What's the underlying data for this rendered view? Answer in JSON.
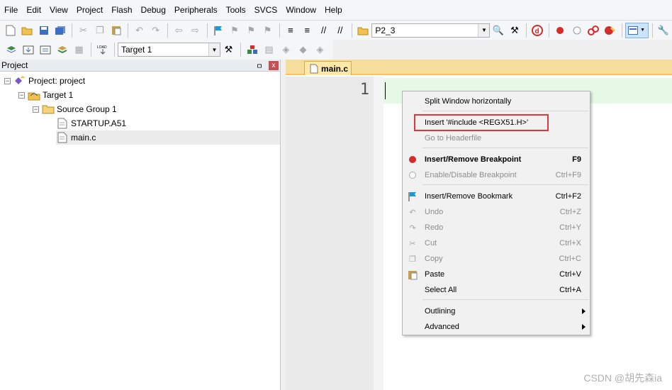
{
  "menu": [
    "File",
    "Edit",
    "View",
    "Project",
    "Flash",
    "Debug",
    "Peripherals",
    "Tools",
    "SVCS",
    "Window",
    "Help"
  ],
  "toolbar": {
    "find_combo_value": "P2_3",
    "target_combo_value": "Target 1"
  },
  "project_panel": {
    "title": "Project",
    "pin_glyph": "ㅁ",
    "close_glyph": "x",
    "tree": {
      "root": "Project: project",
      "target": "Target 1",
      "group": "Source Group 1",
      "files": [
        "STARTUP.A51",
        "main.c"
      ]
    }
  },
  "editor": {
    "tab_label": "main.c",
    "line_number": "1"
  },
  "context_menu": {
    "items": [
      {
        "label": "Split Window horizontally",
        "shortcut": "",
        "icon": "none",
        "disabled": false,
        "bold": false
      },
      {
        "label": "Insert '#include <REGX51.H>'",
        "shortcut": "",
        "icon": "none",
        "disabled": false,
        "bold": false
      },
      {
        "label": "Go to Headerfile",
        "shortcut": "",
        "icon": "none",
        "disabled": true,
        "bold": false
      },
      {
        "label": "Insert/Remove Breakpoint",
        "shortcut": "F9",
        "icon": "breakpoint-icon",
        "disabled": false,
        "bold": true
      },
      {
        "label": "Enable/Disable Breakpoint",
        "shortcut": "Ctrl+F9",
        "icon": "breakpoint-disabled-icon",
        "disabled": true,
        "bold": false
      },
      {
        "label": "Insert/Remove Bookmark",
        "shortcut": "Ctrl+F2",
        "icon": "bookmark-icon",
        "disabled": false,
        "bold": false
      },
      {
        "label": "Undo",
        "shortcut": "Ctrl+Z",
        "icon": "undo-icon",
        "disabled": true,
        "bold": false
      },
      {
        "label": "Redo",
        "shortcut": "Ctrl+Y",
        "icon": "redo-icon",
        "disabled": true,
        "bold": false
      },
      {
        "label": "Cut",
        "shortcut": "Ctrl+X",
        "icon": "cut-icon",
        "disabled": true,
        "bold": false
      },
      {
        "label": "Copy",
        "shortcut": "Ctrl+C",
        "icon": "copy-icon",
        "disabled": true,
        "bold": false
      },
      {
        "label": "Paste",
        "shortcut": "Ctrl+V",
        "icon": "paste-icon",
        "disabled": false,
        "bold": false
      },
      {
        "label": "Select All",
        "shortcut": "Ctrl+A",
        "icon": "none",
        "disabled": false,
        "bold": false
      },
      {
        "label": "Outlining",
        "shortcut": "",
        "icon": "none",
        "disabled": false,
        "bold": false
      },
      {
        "label": "Advanced",
        "shortcut": "",
        "icon": "none",
        "disabled": false,
        "bold": false
      }
    ]
  },
  "watermark": "CSDN @胡先森ia",
  "colors": {
    "highlight_box": "#e0373b",
    "tab_strip": "#f7dd9b",
    "code_line": "#e6f8e6",
    "breakpoint": "#d42b2b"
  }
}
